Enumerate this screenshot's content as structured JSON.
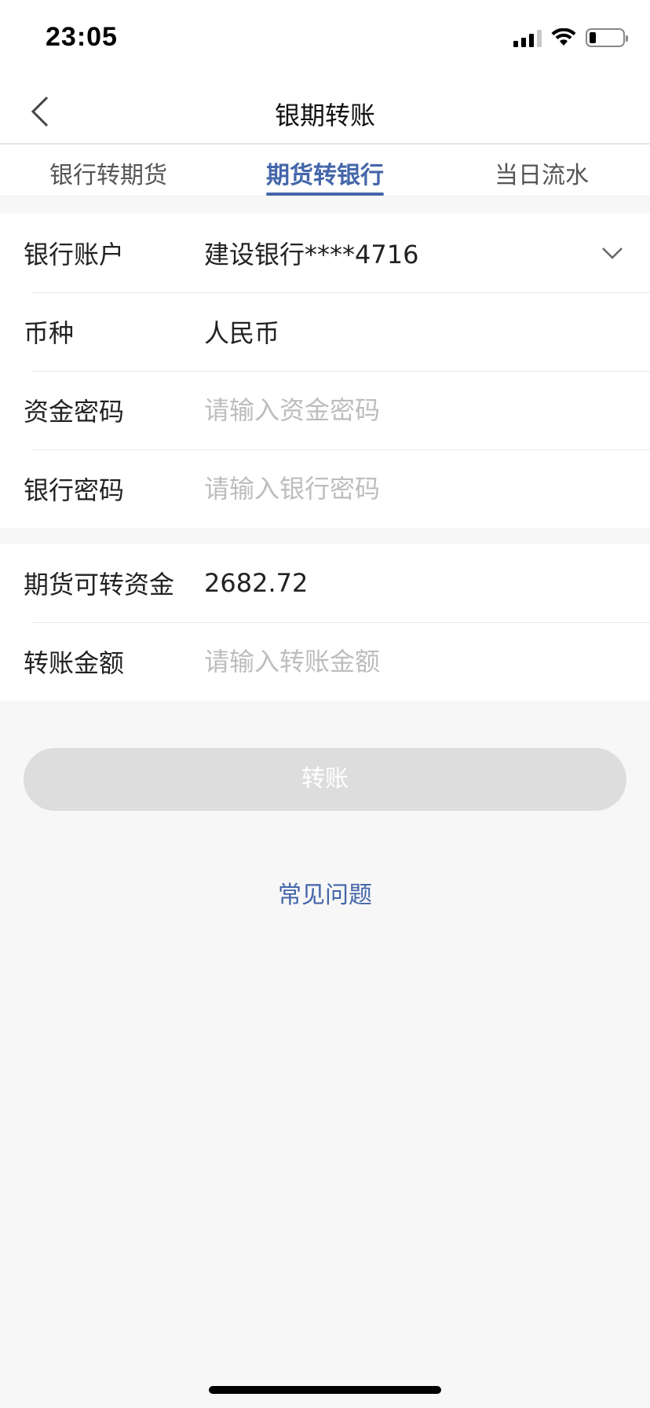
{
  "status_bar": {
    "time": "23:05"
  },
  "nav": {
    "title": "银期转账"
  },
  "tabs": [
    {
      "label": "银行转期货",
      "active": false
    },
    {
      "label": "期货转银行",
      "active": true
    },
    {
      "label": "当日流水",
      "active": false
    }
  ],
  "form": {
    "bank_account": {
      "label": "银行账户",
      "value": "建设银行****4716"
    },
    "currency": {
      "label": "币种",
      "value": "人民币"
    },
    "fund_password": {
      "label": "资金密码",
      "placeholder": "请输入资金密码",
      "value": ""
    },
    "bank_password": {
      "label": "银行密码",
      "placeholder": "请输入银行密码",
      "value": ""
    },
    "available_funds": {
      "label": "期货可转资金",
      "value": "2682.72"
    },
    "transfer_amount": {
      "label": "转账金额",
      "placeholder": "请输入转账金额",
      "value": ""
    }
  },
  "submit_label": "转账",
  "faq_label": "常见问题",
  "colors": {
    "accent": "#4466aa",
    "disabled_button": "#dddddd",
    "background": "#f7f7f7"
  }
}
